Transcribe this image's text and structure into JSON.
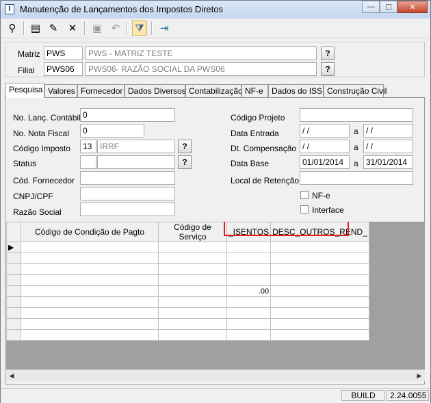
{
  "window": {
    "title": "Manutenção de Lançamentos dos Impostos Diretos",
    "app_icon_letter": "I"
  },
  "title_buttons": {
    "minimize": "—",
    "maximize": "☐",
    "close": "✕"
  },
  "toolbar": {
    "icons": [
      "binoculars-icon",
      "new-document-icon",
      "edit-icon",
      "delete-icon",
      "save-icon",
      "undo-icon",
      "filter-icon",
      "exit-icon"
    ],
    "glyphs": {
      "search": "⚲",
      "new": "▤",
      "edit": "✎",
      "delete": "✕",
      "save": "▣",
      "undo": "↶",
      "filter": "⧩",
      "exit": "⇥"
    }
  },
  "header": {
    "matriz_label": "Matriz",
    "matriz_code": "PWS",
    "matriz_name": "PWS - MATRIZ TESTE",
    "filial_label": "Filial",
    "filial_code": "PWS06",
    "filial_name": "PWS06- RAZÃO SOCIAL DA PWS06",
    "lookup_label": "?"
  },
  "tabs": [
    "Pesquisa",
    "Valores",
    "Fornecedor",
    "Dados Diversos",
    "Contabilização",
    "NF-e",
    "Dados do ISS",
    "Construção Civil"
  ],
  "form": {
    "no_lanc_label": "No. Lanç. Contábil",
    "no_lanc_value": "0",
    "no_nota_label": "No. Nota Fiscal",
    "no_nota_value": "0",
    "cod_imposto_label": "Código Imposto",
    "cod_imposto_code": "13",
    "cod_imposto_name": "IRRF",
    "status_label": "Status",
    "status_value": "",
    "status_desc": "",
    "cod_fornecedor_label": "Cód. Fornecedor",
    "cod_fornecedor_value": "",
    "cnpj_label": "CNPJ/CPF",
    "cnpj_value": "",
    "razao_label": "Razão Social",
    "razao_value": "",
    "cod_projeto_label": "Código Projeto",
    "cod_projeto_value": "",
    "data_entrada_label": "Data Entrada",
    "data_entrada_from": " / /",
    "data_entrada_to": " / /",
    "dt_comp_label": "Dt. Compensação",
    "dt_comp_from": " / /",
    "dt_comp_to": " / /",
    "data_base_label": "Data Base",
    "data_base_from": "01/01/2014",
    "data_base_to": "31/01/2014",
    "local_ret_label": "Local de Retenção",
    "local_ret_value": "",
    "a_label": "a",
    "nfe_label": "NF-e",
    "interface_label": "Interface"
  },
  "grid": {
    "columns": [
      "Código de Condição de Pagto",
      "Código de Serviço",
      "_ISENTOS",
      "DESC_OUTROS_REND_"
    ],
    "row_indicator": "▶",
    "rows": [
      [
        "",
        "",
        "",
        ""
      ],
      [
        "",
        "",
        "",
        ""
      ],
      [
        "",
        "",
        "",
        ""
      ],
      [
        "",
        "",
        "",
        ""
      ],
      [
        "",
        "",
        ".00",
        ""
      ],
      [
        "",
        "",
        "",
        ""
      ],
      [
        "",
        "",
        "",
        ""
      ],
      [
        "",
        "",
        "",
        ""
      ],
      [
        "",
        "",
        "",
        ""
      ]
    ]
  },
  "scroll": {
    "left": "◀",
    "right": "▶"
  },
  "status": {
    "build_label": "BUILD",
    "version": "2.24.0055"
  }
}
